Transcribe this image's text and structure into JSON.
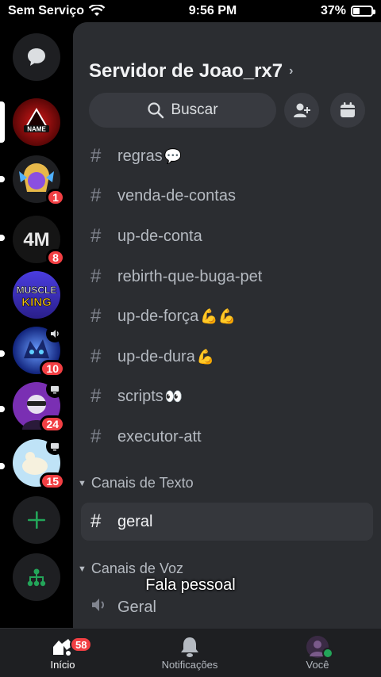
{
  "status_bar": {
    "carrier": "Sem Serviço",
    "time": "9:56 PM",
    "battery": "37%",
    "battery_level": 0.37
  },
  "server_rail": {
    "servers": [
      {
        "name_hint": "NAME",
        "badge": "",
        "active": true,
        "colors": [
          "#7a0b0b",
          "#d01818"
        ]
      },
      {
        "badge": "1",
        "colors": [
          "#6a3fc4",
          "#e7b84a"
        ]
      },
      {
        "badge": "8",
        "colors": [
          "#111111",
          "#555555"
        ]
      },
      {
        "name_hint": "MUSCLE KING",
        "badge": "",
        "colors": [
          "#3a2db5",
          "#f5c518"
        ]
      },
      {
        "badge": "10",
        "sub_icon": "speaker-icon",
        "colors": [
          "#1c2fa8",
          "#5fd0ff"
        ]
      },
      {
        "badge": "24",
        "sub_icon": "screen-share-icon",
        "colors": [
          "#7a2fb3",
          "#e7e7ef"
        ]
      },
      {
        "badge": "15",
        "sub_icon": "screen-share-icon",
        "colors": [
          "#a9d8f5",
          "#f4f0dc"
        ]
      }
    ]
  },
  "header": {
    "server_name": "Servidor de Joao_rx7",
    "search_label": "Buscar"
  },
  "channels": {
    "top": [
      {
        "name": "regras",
        "emoji": "💬"
      },
      {
        "name": "venda-de-contas",
        "emoji": ""
      },
      {
        "name": "up-de-conta",
        "emoji": ""
      },
      {
        "name": "rebirth-que-buga-pet",
        "emoji": ""
      },
      {
        "name": "up-de-força",
        "emoji": "💪💪"
      },
      {
        "name": "up-de-dura",
        "emoji": "💪"
      },
      {
        "name": "scripts",
        "emoji": "👀"
      },
      {
        "name": "executor-att",
        "emoji": ""
      }
    ],
    "text_category": "Canais de Texto",
    "text_channels": [
      {
        "name": "geral"
      }
    ],
    "voice_category": "Canais de Voz",
    "voice_channels": [
      {
        "name": "Geral"
      }
    ]
  },
  "caption": "Fala pessoal",
  "tabbar": {
    "home_label": "Início",
    "home_badge": "58",
    "notifications_label": "Notificações",
    "you_label": "Você"
  },
  "colors": {
    "accent_red": "#f23f43",
    "online_green": "#23a559",
    "panel_bg": "#2b2d31"
  }
}
